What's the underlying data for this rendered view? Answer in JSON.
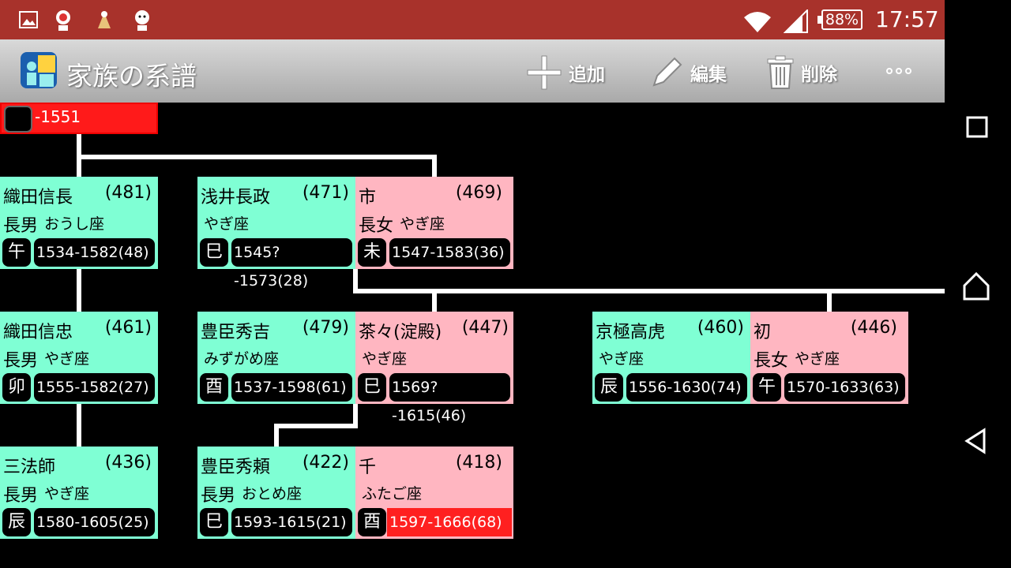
{
  "status": {
    "battery": "88%",
    "time": "17:57"
  },
  "app": {
    "title": "家族の系譜"
  },
  "actions": {
    "add": "追加",
    "edit": "編集",
    "delete": "削除"
  },
  "top_card": {
    "years": "-1551"
  },
  "persons": {
    "nobunaga": {
      "name": "織田信長",
      "num": "(481)",
      "relation": "長男",
      "sign": "おうし座",
      "zodiac": "午",
      "years": "1534-1582(48)"
    },
    "azai": {
      "name": "浅井長政",
      "num": "(471)",
      "relation": "",
      "sign": "やぎ座",
      "zodiac": "巳",
      "years": "1545?-1573(28)"
    },
    "ichi": {
      "name": "市",
      "num": "(469)",
      "relation": "長女",
      "sign": "やぎ座",
      "zodiac": "未",
      "years": "1547-1583(36)"
    },
    "nobutada": {
      "name": "織田信忠",
      "num": "(461)",
      "relation": "長男",
      "sign": "やぎ座",
      "zodiac": "卯",
      "years": "1555-1582(27)"
    },
    "hideyoshi": {
      "name": "豊臣秀吉",
      "num": "(479)",
      "relation": "",
      "sign": "みずがめ座",
      "zodiac": "酉",
      "years": "1537-1598(61)"
    },
    "chacha": {
      "name": "茶々(淀殿)",
      "num": "(447)",
      "relation": "",
      "sign": "やぎ座",
      "zodiac": "巳",
      "years": "1569?-1615(46)"
    },
    "takatsugu": {
      "name": "京極高虎",
      "num": "(460)",
      "relation": "",
      "sign": "やぎ座",
      "zodiac": "辰",
      "years": "1556-1630(74)"
    },
    "hatsu": {
      "name": "初",
      "num": "(446)",
      "relation": "長女",
      "sign": "やぎ座",
      "zodiac": "午",
      "years": "1570-1633(63)"
    },
    "sanboshi": {
      "name": "三法師",
      "num": "(436)",
      "relation": "長男",
      "sign": "やぎ座",
      "zodiac": "辰",
      "years": "1580-1605(25)"
    },
    "hideyori": {
      "name": "豊臣秀頼",
      "num": "(422)",
      "relation": "長男",
      "sign": "おとめ座",
      "zodiac": "巳",
      "years": "1593-1615(21)"
    },
    "sen": {
      "name": "千",
      "num": "(418)",
      "relation": "",
      "sign": "ふたご座",
      "zodiac": "酉",
      "years": "1597-1666(68)"
    }
  }
}
